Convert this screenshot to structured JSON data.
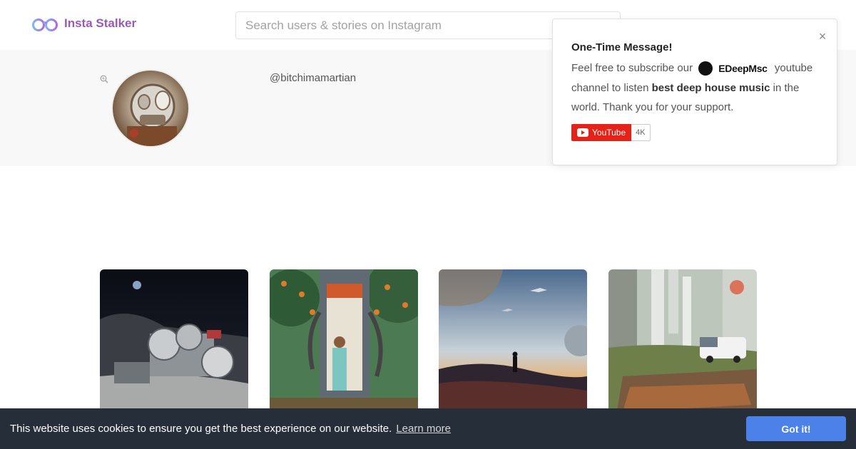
{
  "header": {
    "brand": "Insta Stalker",
    "search_placeholder": "Search users & stories on Instagram"
  },
  "profile": {
    "username": "@bitchimamartian"
  },
  "popup": {
    "title": "One-Time Message!",
    "text_before": "Feel free to subscribe our",
    "channel_name": "EDeepMsc",
    "text_after": "youtube channel to listen",
    "bold_text": "best deep house music",
    "text_end": "in the world. Thank you for your support.",
    "youtube_label": "YouTube",
    "subscriber_count": "4K"
  },
  "cookie": {
    "message": "This website uses cookies to ensure you get the best experience on our website.",
    "learn_more": "Learn more",
    "button": "Got it!"
  },
  "colors": {
    "brand": "#9b59b6",
    "cookie_bg": "#252e39",
    "cookie_button": "#4b81e8",
    "youtube_red": "#e62117"
  }
}
